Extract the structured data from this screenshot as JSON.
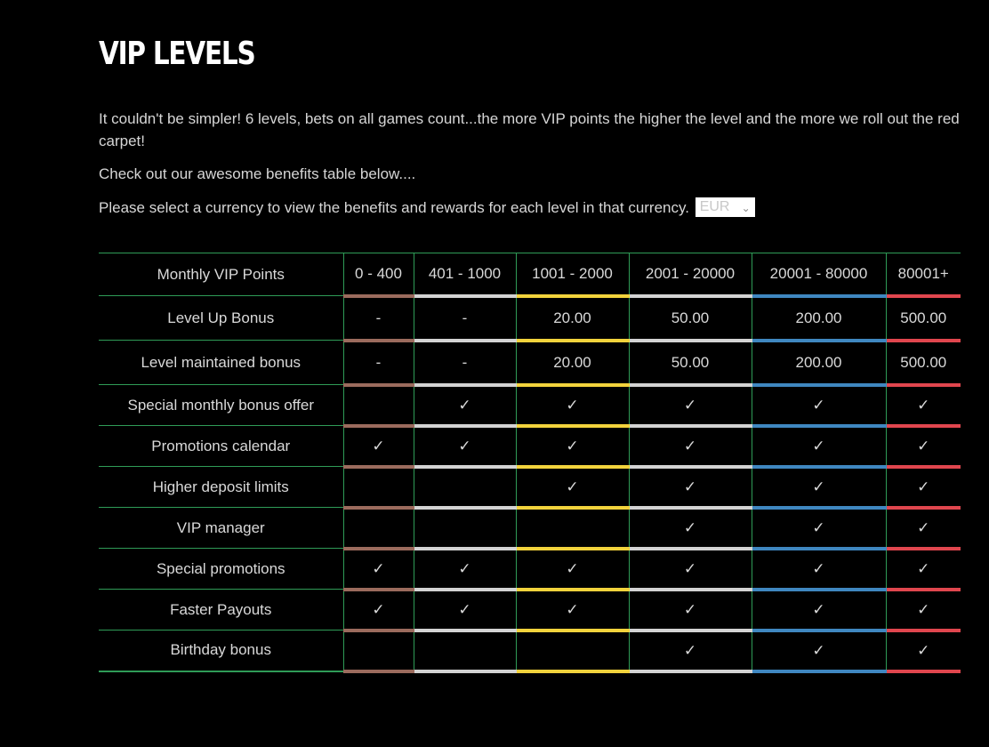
{
  "title": "VIP LEVELS",
  "intro": {
    "p1": "It couldn't be simpler! 6 levels, bets on all games count...the more VIP points the higher the level and the more we roll out the red carpet!",
    "p2": "Check out our awesome benefits table below....",
    "p3": "Please select a currency to view the benefits and rewards for each level in that currency.",
    "currency": "EUR"
  },
  "levels": [
    {
      "range": "0 - 400",
      "color": "#9b6b5d"
    },
    {
      "range": "401 - 1000",
      "color": "#d3d3d3"
    },
    {
      "range": "1001 - 2000",
      "color": "#f2d33c"
    },
    {
      "range": "2001 - 20000",
      "color": "#d3d3d3"
    },
    {
      "range": "20001 - 80000",
      "color": "#3f87c0"
    },
    {
      "range": "80001+",
      "color": "#e0464e"
    }
  ],
  "table": {
    "header_label": "Monthly VIP Points",
    "check_mark": "✓",
    "rows": [
      {
        "label": "Level Up Bonus",
        "cells": [
          "-",
          "-",
          "20.00",
          "50.00",
          "200.00",
          "500.00"
        ]
      },
      {
        "label": "Level maintained bonus",
        "cells": [
          "-",
          "-",
          "20.00",
          "50.00",
          "200.00",
          "500.00"
        ]
      },
      {
        "label": "Special monthly bonus offer",
        "cells": [
          false,
          true,
          true,
          true,
          true,
          true
        ]
      },
      {
        "label": "Promotions calendar",
        "cells": [
          true,
          true,
          true,
          true,
          true,
          true
        ]
      },
      {
        "label": "Higher deposit limits",
        "cells": [
          false,
          false,
          true,
          true,
          true,
          true
        ]
      },
      {
        "label": "VIP manager",
        "cells": [
          false,
          false,
          false,
          true,
          true,
          true
        ]
      },
      {
        "label": "Special promotions",
        "cells": [
          true,
          true,
          true,
          true,
          true,
          true
        ]
      },
      {
        "label": "Faster Payouts",
        "cells": [
          true,
          true,
          true,
          true,
          true,
          true
        ]
      },
      {
        "label": "Birthday bonus",
        "cells": [
          false,
          false,
          false,
          true,
          true,
          true
        ]
      }
    ]
  }
}
